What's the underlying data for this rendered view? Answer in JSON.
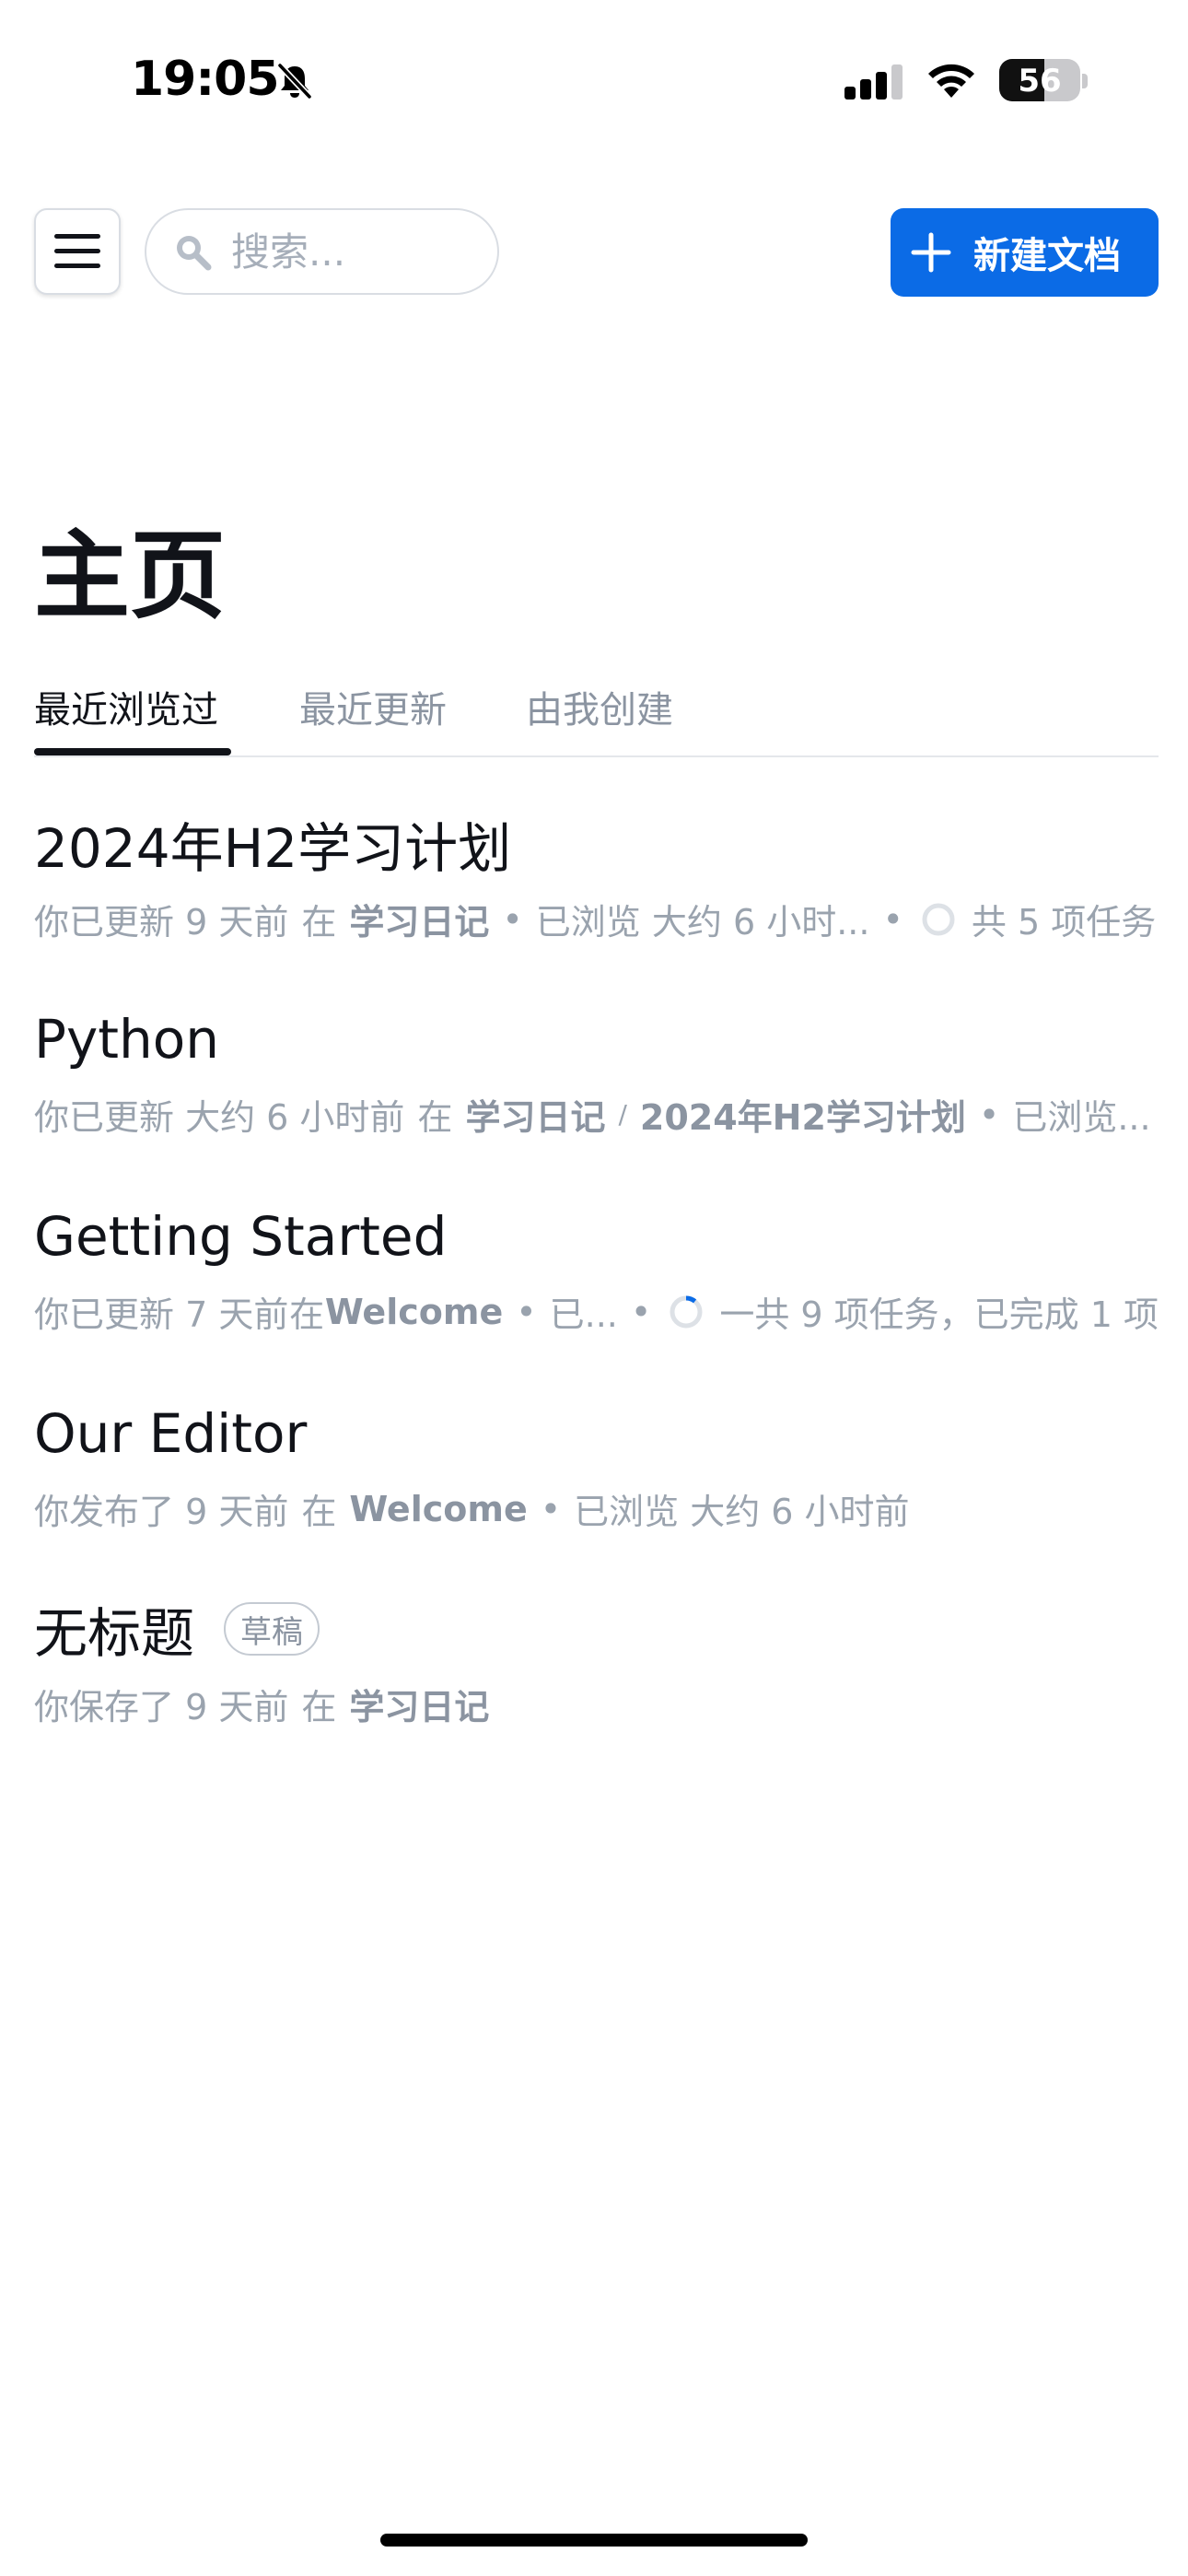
{
  "status_bar": {
    "time": "19:05",
    "battery_level": "56",
    "battery_fraction": 0.56
  },
  "toolbar": {
    "search_placeholder": "搜索...",
    "new_doc_label": "新建文档",
    "accent_color": "#0b6be6"
  },
  "page": {
    "title": "主页"
  },
  "tabs": [
    {
      "label": "最近浏览过",
      "active": true
    },
    {
      "label": "最近更新",
      "active": false
    },
    {
      "label": "由我创建",
      "active": false
    }
  ],
  "docs": [
    {
      "title": "2024年H2学习计划",
      "meta_action": "你已更新 9 天前",
      "meta_in": "在",
      "collection": "学习日记",
      "viewed": "已浏览 大约 6 小时...",
      "tasks": "共 5 项任务",
      "task_progress": 0
    },
    {
      "title": "Python",
      "meta_action": "你已更新 大约 6 小时前",
      "meta_in": "在",
      "collection": "学习日记",
      "path_sep": "/",
      "parent": "2024年H2学习计划",
      "viewed": "已浏览..."
    },
    {
      "title": "Getting Started",
      "meta_action": "你已更新 7 天前",
      "meta_in": "在",
      "collection": "Welcome",
      "viewed": "已...",
      "tasks": "一共 9 项任务，已完成 1 项",
      "task_progress": 0.11
    },
    {
      "title": "Our Editor",
      "meta_action": "你发布了 9 天前",
      "meta_in": "在",
      "collection": "Welcome",
      "viewed": "已浏览 大约 6 小时前"
    },
    {
      "title": "无标题",
      "badge": "草稿",
      "meta_action": "你保存了 9 天前",
      "meta_in": "在",
      "collection": "学习日记"
    }
  ],
  "meta_dot": "•",
  "icons": {
    "menu": "hamburger-menu-icon",
    "search": "search-icon",
    "new": "plus-icon",
    "bell": "bell-slash-icon",
    "signal": "cellular-signal-icon",
    "wifi": "wifi-icon",
    "progress": "progress-ring-icon"
  }
}
